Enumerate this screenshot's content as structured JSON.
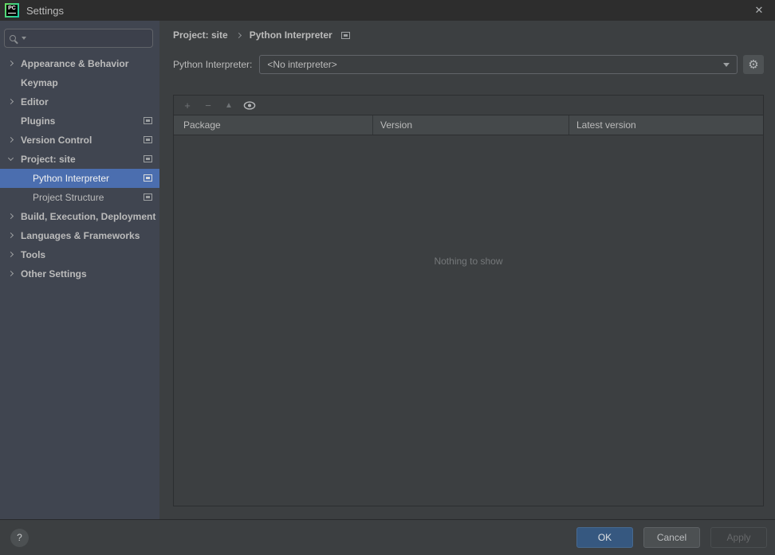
{
  "titlebar": {
    "title": "Settings",
    "logo_text": "PC",
    "close_glyph": "✕"
  },
  "icons": {
    "pycharm-logo": "PC badge",
    "search-icon": "css-magnifier",
    "search-history-icon": "css-triangle-down",
    "chevron-right-icon": "css-chevron",
    "chevron-down-icon": "css-chevron",
    "settings-page-icon": "css-screen-square",
    "plus-icon": "+",
    "minus-icon": "−",
    "upgrade-icon": "▲",
    "eye-icon": "css-eye",
    "gear-icon": "⚙",
    "combo-arrow-icon": "css-triangle-down",
    "help-icon": "?",
    "close-icon": "✕"
  },
  "sidebar": {
    "items": [
      {
        "label": "Appearance & Behavior",
        "level": "top",
        "chevron": "right",
        "page_icon": false,
        "selected": false
      },
      {
        "label": "Keymap",
        "level": "top",
        "chevron": "none",
        "page_icon": false,
        "selected": false
      },
      {
        "label": "Editor",
        "level": "top",
        "chevron": "right",
        "page_icon": false,
        "selected": false
      },
      {
        "label": "Plugins",
        "level": "top",
        "chevron": "none",
        "page_icon": true,
        "selected": false
      },
      {
        "label": "Version Control",
        "level": "top",
        "chevron": "right",
        "page_icon": true,
        "selected": false
      },
      {
        "label": "Project: site",
        "level": "top",
        "chevron": "down",
        "page_icon": true,
        "selected": false
      },
      {
        "label": "Python Interpreter",
        "level": "child",
        "chevron": "none",
        "page_icon": true,
        "selected": true
      },
      {
        "label": "Project Structure",
        "level": "child",
        "chevron": "none",
        "page_icon": true,
        "selected": false
      },
      {
        "label": "Build, Execution, Deployment",
        "level": "top",
        "chevron": "right",
        "page_icon": false,
        "selected": false
      },
      {
        "label": "Languages & Frameworks",
        "level": "top",
        "chevron": "right",
        "page_icon": false,
        "selected": false
      },
      {
        "label": "Tools",
        "level": "top",
        "chevron": "right",
        "page_icon": false,
        "selected": false
      },
      {
        "label": "Other Settings",
        "level": "top",
        "chevron": "right",
        "page_icon": false,
        "selected": false
      }
    ]
  },
  "content": {
    "breadcrumb": {
      "first": "Project: site",
      "second": "Python Interpreter"
    },
    "interpreter": {
      "label": "Python Interpreter:",
      "value": "<No interpreter>"
    },
    "toolbar": {
      "add": "+",
      "remove": "−",
      "upgrade": "▲"
    },
    "table": {
      "columns": [
        "Package",
        "Version",
        "Latest version"
      ],
      "rows": [],
      "empty_text": "Nothing to show"
    }
  },
  "footer": {
    "help": "?",
    "ok": "OK",
    "cancel": "Cancel",
    "apply": "Apply"
  },
  "colors": {
    "selection_blue": "#4b6eaf",
    "ok_button_blue": "#365880",
    "dialog_bg": "#3c3f41",
    "sidebar_bg": "#404550",
    "titlebar_bg": "#2d2d2d",
    "header_row_bg": "#45494b"
  }
}
